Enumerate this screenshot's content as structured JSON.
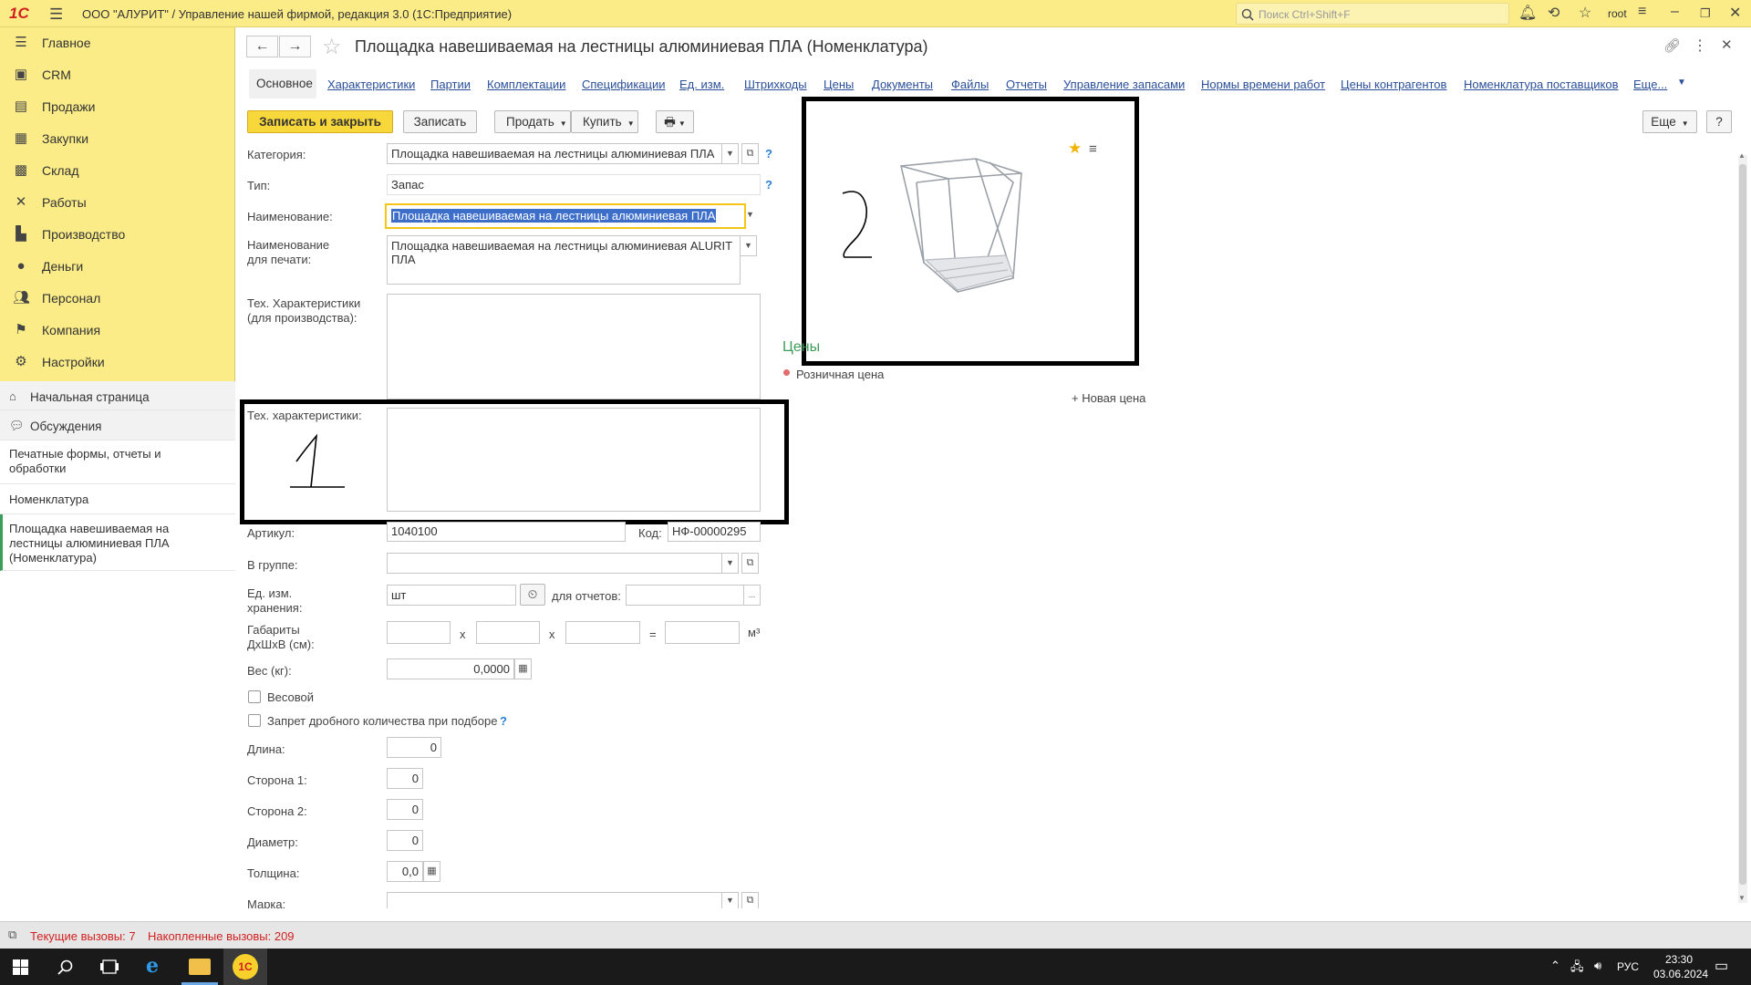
{
  "app": {
    "logo": "1С",
    "window_title": "ООО \"АЛУРИТ\" / Управление нашей фирмой, редакция 3.0  (1С:Предприятие)",
    "search_placeholder": "Поиск Ctrl+Shift+F",
    "user": "root"
  },
  "sidebar": {
    "items": [
      {
        "label": "Главное",
        "icon": "menu-icon"
      },
      {
        "label": "CRM",
        "icon": "crm-icon"
      },
      {
        "label": "Продажи",
        "icon": "sales-icon"
      },
      {
        "label": "Закупки",
        "icon": "purchases-icon"
      },
      {
        "label": "Склад",
        "icon": "warehouse-icon"
      },
      {
        "label": "Работы",
        "icon": "works-icon"
      },
      {
        "label": "Производство",
        "icon": "production-icon"
      },
      {
        "label": "Деньги",
        "icon": "money-icon"
      },
      {
        "label": "Персонал",
        "icon": "staff-icon"
      },
      {
        "label": "Компания",
        "icon": "company-icon"
      },
      {
        "label": "Настройки",
        "icon": "settings-icon"
      }
    ],
    "home": "Начальная страница",
    "discussions": "Обсуждения",
    "print_forms": "Печатные формы, отчеты и обработки",
    "nomenclature": "Номенклатура",
    "open_item": "Площадка навешиваемая на лестницы алюминиевая ПЛА (Номенклатура)"
  },
  "form": {
    "title": "Площадка навешиваемая на лестницы алюминиевая ПЛА (Номенклатура)",
    "tabs": [
      "Основное",
      "Характеристики",
      "Партии",
      "Комплектации",
      "Спецификации",
      "Ед. изм.",
      "Штрихкоды",
      "Цены",
      "Документы",
      "Файлы",
      "Отчеты",
      "Управление запасами",
      "Нормы времени работ",
      "Цены контрагентов",
      "Номенклатура поставщиков",
      "Еще..."
    ],
    "buttons": {
      "save_close": "Записать и закрыть",
      "save": "Записать",
      "sell": "Продать",
      "buy": "Купить",
      "more": "Еще",
      "help": "?"
    },
    "fields": {
      "category_label": "Категория:",
      "category_value": "Площадка навешиваемая на лестницы алюминиевая ПЛА",
      "type_label": "Тип:",
      "type_value": "Запас",
      "name_label": "Наименование:",
      "name_value": "Площадка навешиваемая на лестницы алюминиевая ПЛА",
      "print_name_label_1": "Наименование",
      "print_name_label_2": "для печати:",
      "print_name_value": "Площадка навешиваемая на лестницы алюминиевая ALURIT ПЛА",
      "tech_prod_label_1": "Тех. Характеристики",
      "tech_prod_label_2": "(для производства):",
      "tech_label": "Тех. характеристики:",
      "article_label": "Артикул:",
      "article_value": "1040100",
      "code_label": "Код:",
      "code_value": "НФ-00000295",
      "group_label": "В группе:",
      "unit_label_1": "Ед. изм.",
      "unit_label_2": "хранения:",
      "unit_value": "шт",
      "reports_label": "для отчетов:",
      "reports_value": "...",
      "dims_label_1": "Габариты",
      "dims_label_2": "ДхШхВ (см):",
      "x1": "x",
      "x2": "x",
      "eq": "=",
      "m3": "м³",
      "weight_label": "Вес (кг):",
      "weight_value": "0,0000",
      "weighted_label": "Весовой",
      "no_fraction_label": "Запрет дробного количества при подборе",
      "length_label": "Длина:",
      "length_value": "0",
      "side1_label": "Сторона 1:",
      "side1_value": "0",
      "side2_label": "Сторона 2:",
      "side2_value": "0",
      "diameter_label": "Диаметр:",
      "diameter_value": "0",
      "thickness_label": "Толщина:",
      "thickness_value": "0,0",
      "brand_label": "Марка:"
    },
    "prices": {
      "title": "Цены",
      "retail": "Розничная цена",
      "new_price": "+ Новая цена"
    },
    "annotations": {
      "mark_1": "1",
      "mark_2": "2"
    }
  },
  "status": {
    "current_calls": "Текущие вызовы: 7",
    "accumulated_calls": "Накопленные вызовы: 209"
  },
  "taskbar": {
    "lang": "РУС",
    "time": "23:30",
    "date": "03.06.2024"
  }
}
